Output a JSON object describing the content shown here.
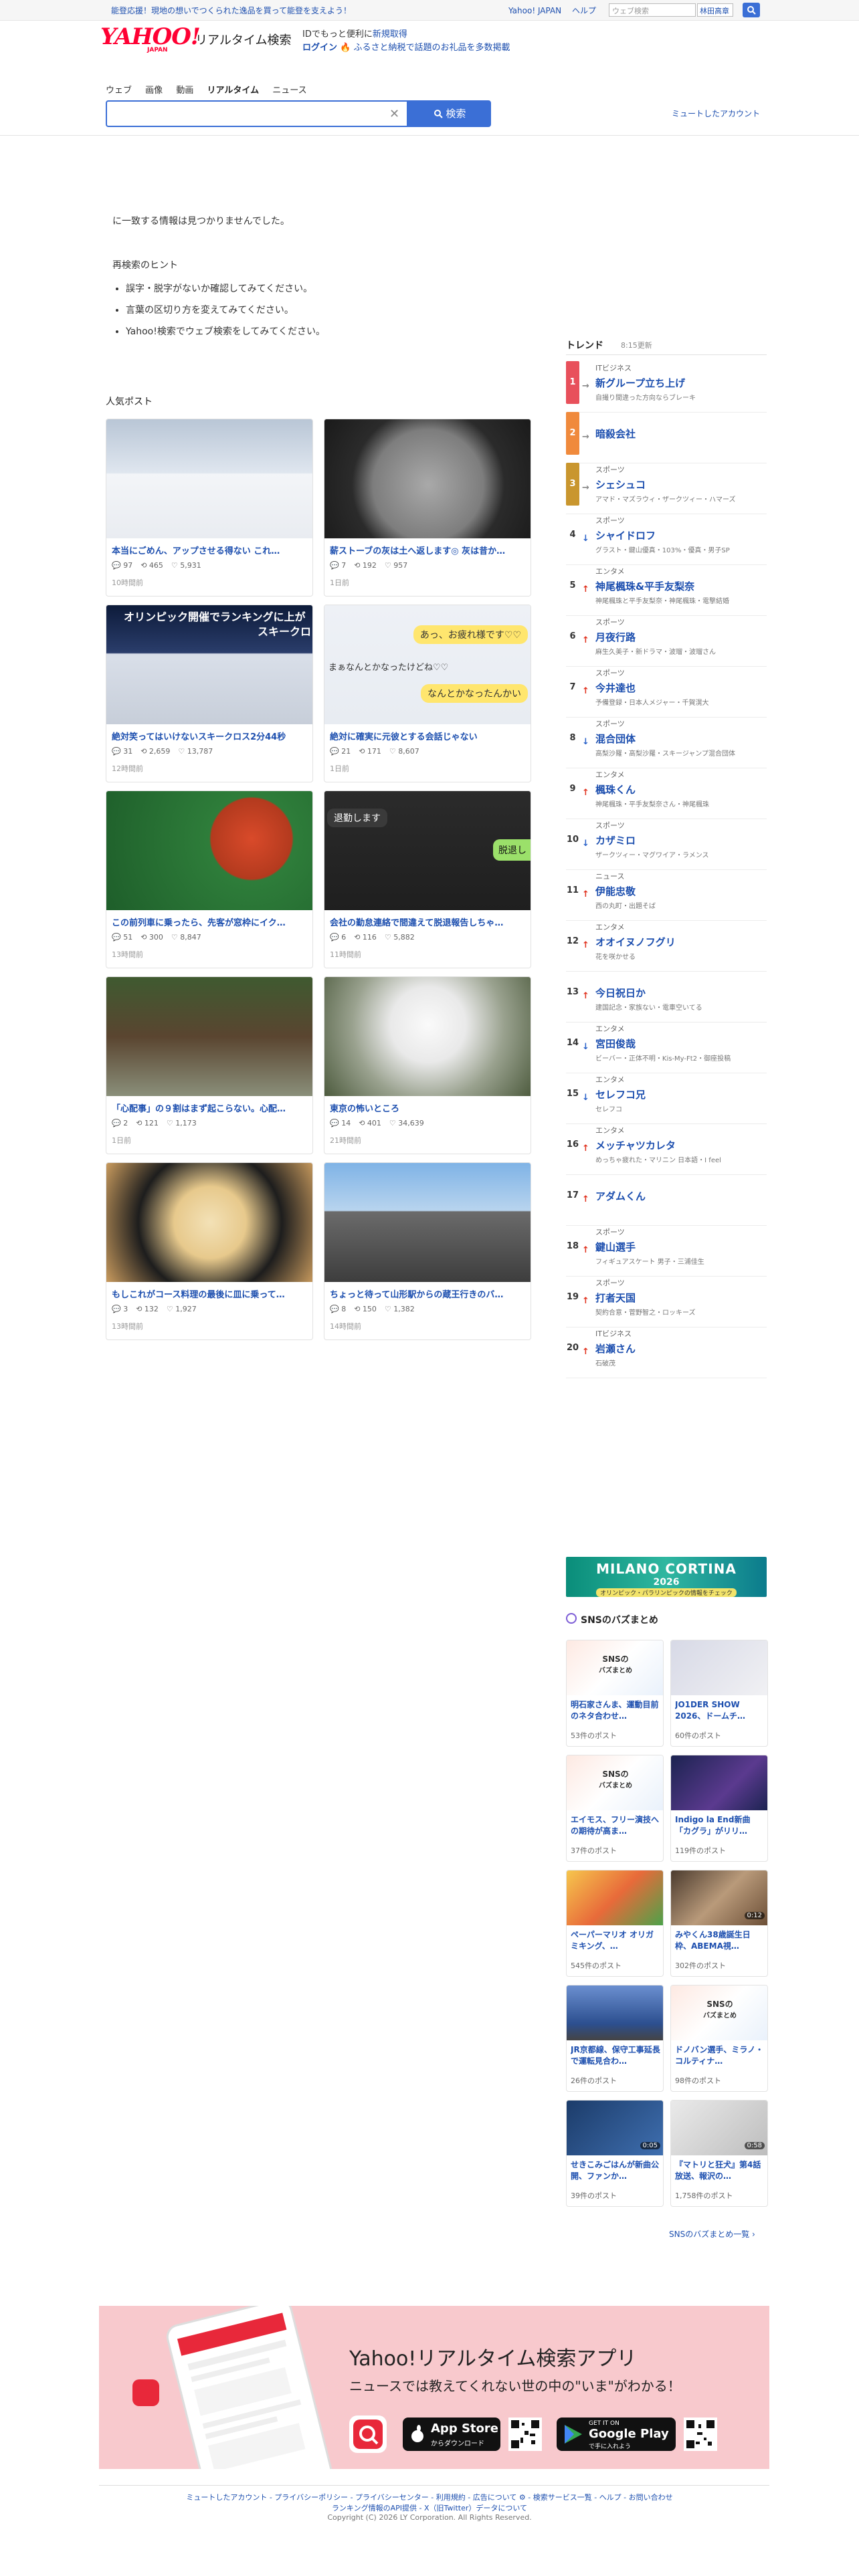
{
  "topbar": {
    "promo": "能登応援！現地の想いでつくられた逸品を買って能登を支えよう！",
    "links": [
      "Yahoo! JAPAN",
      "ヘルプ"
    ],
    "search_placeholder": "ウェブ検索",
    "search_btn": "林田高章",
    "go": "Q"
  },
  "header": {
    "logo_text": "YAHOO!",
    "logo_sub": "JAPAN",
    "service": "リアルタイム検索",
    "login_line1_prefix": "IDでもっと便利に",
    "login_line1_link": "新規取得",
    "login_line2_link": "ログイン",
    "login_line2_rest": "🔥 ふるさと納税で話題のお礼品を多数掲載"
  },
  "tabs": [
    "ウェブ",
    "画像",
    "動画",
    "リアルタイム",
    "ニュース"
  ],
  "search": {
    "value": "",
    "button": "検索",
    "muted_link": "ミュートしたアカウント"
  },
  "notice": {
    "no_result": "に一致する情報は見つかりませんでした。",
    "hint_title": "再検索のヒント",
    "hints": [
      "誤字・脱字がないか確認してみてください。",
      "言葉の区切り方を変えてみてください。",
      "Yahoo!検索でウェブ検索をしてみてください。"
    ]
  },
  "posts": {
    "title": "人気ポスト",
    "items": [
      {
        "title": "本当にごめん、アップさせる得ない これ…",
        "replies": "97",
        "reposts": "465",
        "likes": "5,931",
        "time": "10時間前"
      },
      {
        "title": "薪ストーブの灰は土へ返します◎ 灰は昔か…",
        "replies": "7",
        "reposts": "192",
        "likes": "957",
        "time": "1日前"
      },
      {
        "title": "絶対笑ってはいけないスキークロス2分44秒",
        "replies": "31",
        "reposts": "2,659",
        "likes": "13,787",
        "time": "12時間前"
      },
      {
        "title": "絶対に確実に元彼とする会話じゃない",
        "replies": "21",
        "reposts": "171",
        "likes": "8,607",
        "time": "1日前"
      },
      {
        "title": "この前列車に乗ったら、先客が窓枠にイク…",
        "replies": "51",
        "reposts": "300",
        "likes": "8,847",
        "time": "13時間前"
      },
      {
        "title": "会社の勤怠連絡で間違えて脱退報告しちゃ…",
        "replies": "6",
        "reposts": "116",
        "likes": "5,882",
        "time": "11時間前"
      },
      {
        "title": "「心配事」の９割はまず起こらない。心配…",
        "replies": "2",
        "reposts": "121",
        "likes": "1,173",
        "time": "1日前"
      },
      {
        "title": "東京の怖いところ",
        "replies": "14",
        "reposts": "401",
        "likes": "34,639",
        "time": "21時間前"
      },
      {
        "title": "もしこれがコース料理の最後に皿に乗って…",
        "replies": "3",
        "reposts": "132",
        "likes": "1,927",
        "time": "13時間前"
      },
      {
        "title": "ちょっと待って山形駅からの蔵王行きのバ…",
        "replies": "8",
        "reposts": "150",
        "likes": "1,382",
        "time": "14時間前"
      }
    ],
    "image_texts": {
      "olympic": "オリンピック開催でランキングに上が",
      "skicross": "スキークロ",
      "chat1": "あっ、お疲れ様です♡♡",
      "chat2": "まぁなんとかなったけどね♡♡",
      "chat3": "なんとかなったんかい",
      "retire": "退勤します",
      "retire2": "脱退し"
    }
  },
  "trends": {
    "title": "トレンド",
    "updated": "8:15更新",
    "items": [
      {
        "rank": "1",
        "cat": "ITビジネス",
        "name": "新グループ立ち上げ",
        "sub": "自撮り間違った方向ならブレーキ",
        "dir": "→",
        "color": "#e8505b"
      },
      {
        "rank": "2",
        "cat": "",
        "name": "暗殺会社",
        "sub": "",
        "dir": "→",
        "color": "#f08a3c"
      },
      {
        "rank": "3",
        "cat": "スポーツ",
        "name": "シェシュコ",
        "sub": "アマド・マズラウィ・ザークツィー・ハマーズ",
        "dir": "→",
        "color": "#c9962e"
      },
      {
        "rank": "4",
        "cat": "スポーツ",
        "name": "シャイドロフ",
        "sub": "グラスト・鍵山優真・103%・優真・男子SP",
        "dir": "↓",
        "color": ""
      },
      {
        "rank": "5",
        "cat": "エンタメ",
        "name": "神尾楓珠&平手友梨奈",
        "sub": "神尾楓珠と平手友梨奈・神尾楓珠・電撃結婚",
        "dir": "↑",
        "color": ""
      },
      {
        "rank": "6",
        "cat": "スポーツ",
        "name": "月夜行路",
        "sub": "麻生久美子・新ドラマ・波瑠・波瑠さん",
        "dir": "↑",
        "color": ""
      },
      {
        "rank": "7",
        "cat": "スポーツ",
        "name": "今井達也",
        "sub": "予備登録・日本人メジャー・千賀滉大",
        "dir": "↑",
        "color": ""
      },
      {
        "rank": "8",
        "cat": "スポーツ",
        "name": "混合団体",
        "sub": "高梨沙羅・高梨沙羅・スキージャンプ混合団体",
        "dir": "↓",
        "color": ""
      },
      {
        "rank": "9",
        "cat": "エンタメ",
        "name": "楓珠くん",
        "sub": "神尾楓珠・平手友梨奈さん・神尾楓珠",
        "dir": "↑",
        "color": ""
      },
      {
        "rank": "10",
        "cat": "スポーツ",
        "name": "カザミロ",
        "sub": "ザークツィー・マグワイア・ラメンス",
        "dir": "↓",
        "color": ""
      },
      {
        "rank": "11",
        "cat": "ニュース",
        "name": "伊能忠敬",
        "sub": "西の丸町・出題そば",
        "dir": "↑",
        "color": ""
      },
      {
        "rank": "12",
        "cat": "エンタメ",
        "name": "オオイヌノフグリ",
        "sub": "花を咲かせる",
        "dir": "↑",
        "color": ""
      },
      {
        "rank": "13",
        "cat": "",
        "name": "今日祝日か",
        "sub": "建国記念・家族ない・電車空いてる",
        "dir": "↑",
        "color": ""
      },
      {
        "rank": "14",
        "cat": "エンタメ",
        "name": "宮田俊哉",
        "sub": "ビーバー・正体不明・Kis-My-Ft2・御座投稿",
        "dir": "↓",
        "color": ""
      },
      {
        "rank": "15",
        "cat": "エンタメ",
        "name": "セレフコ兄",
        "sub": "セレフコ",
        "dir": "↓",
        "color": ""
      },
      {
        "rank": "16",
        "cat": "エンタメ",
        "name": "メッチャツカレタ",
        "sub": "めっちゃ疲れた・マリニン 日本語・I feel",
        "dir": "↑",
        "color": ""
      },
      {
        "rank": "17",
        "cat": "",
        "name": "アダムくん",
        "sub": "",
        "dir": "↑",
        "color": ""
      },
      {
        "rank": "18",
        "cat": "スポーツ",
        "name": "鍵山選手",
        "sub": "フィギュアスケート 男子・三浦佳生",
        "dir": "↑",
        "color": ""
      },
      {
        "rank": "19",
        "cat": "スポーツ",
        "name": "打者天国",
        "sub": "契約合意・菅野智之・ロッキーズ",
        "dir": "↑",
        "color": ""
      },
      {
        "rank": "20",
        "cat": "ITビジネス",
        "name": "岩瀬さん",
        "sub": "石破茂",
        "dir": "↑",
        "color": ""
      }
    ]
  },
  "milano": {
    "line1": "MILANO CORTINA",
    "line2": "2026",
    "line3": "オリンピック・パラリンピックの情報をチェック"
  },
  "sns": {
    "title": "SNSのバズまとめ",
    "items": [
      {
        "title": "明石家さんま、運動目前のネタ合わせ…",
        "count": "53件のポスト",
        "dur": ""
      },
      {
        "title": "JO1DER SHOW 2026、ドームチ…",
        "count": "60件のポスト",
        "dur": ""
      },
      {
        "title": "エイモス、フリー演技への期待が高ま…",
        "count": "37件のポスト",
        "dur": ""
      },
      {
        "title": "Indigo la End新曲「カグラ」がリリ…",
        "count": "119件のポスト",
        "dur": ""
      },
      {
        "title": "ペーパーマリオ オリガミキング、…",
        "count": "545件のポスト",
        "dur": ""
      },
      {
        "title": "みやくん38歳誕生日枠、ABEMA視…",
        "count": "302件のポスト",
        "dur": "0:12"
      },
      {
        "title": "JR京都線、保守工事延長で運転見合わ…",
        "count": "26件のポスト",
        "dur": ""
      },
      {
        "title": "ドノバン選手、ミラノ・コルティナ…",
        "count": "98件のポスト",
        "dur": ""
      },
      {
        "title": "せきこみごはんが新曲公開、ファンか…",
        "count": "39件のポスト",
        "dur": "0:05"
      },
      {
        "title": "『マトリと狂犬』第4話放送、報沢の…",
        "count": "1,758件のポスト",
        "dur": "0:58"
      }
    ],
    "sns_badge": "SNSの",
    "sns_badge2": "バズまとめ",
    "more": "SNSのバズまとめ一覧 ›"
  },
  "app": {
    "title": "Yahoo!リアルタイム検索アプリ",
    "sub": "ニュースでは教えてくれない世の中の\"いま\"がわかる！",
    "appstore_small": "App Storeから",
    "appstore": "App Store",
    "appstore_dl": "からダウンロード",
    "googleplay_small": "GET IT ON",
    "googleplay": "Google Play",
    "googleplay_dl": "で手に入れよう"
  },
  "footer": {
    "line1": "ミュートしたアカウント - プライバシーポリシー - プライバシーセンター - 利用規約 - 広告について ⚙ - 検索サービス一覧 - ヘルプ - お問い合わせ",
    "line2": "ランキング情報のAPI提供 - X（旧Twitter）データについて",
    "line3": "Copyright (C) 2026 LY Corporation. All Rights Reserved."
  },
  "colors": {
    "brand_red": "#ff0033",
    "link_blue": "#1d4faf",
    "button_blue": "#3b6fd6"
  }
}
